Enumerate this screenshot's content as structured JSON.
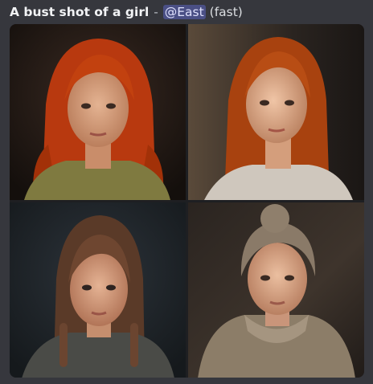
{
  "message": {
    "prompt": "A bust shot of a girl",
    "separator": "-",
    "mention": "@East",
    "mode": "(fast)"
  },
  "image_grid": {
    "tiles": [
      {
        "subject": "portrait-red-hair-olive-top"
      },
      {
        "subject": "portrait-auburn-hair-white-top"
      },
      {
        "subject": "portrait-brown-braids-hoodie"
      },
      {
        "subject": "portrait-messy-bun-hoodie"
      }
    ]
  }
}
